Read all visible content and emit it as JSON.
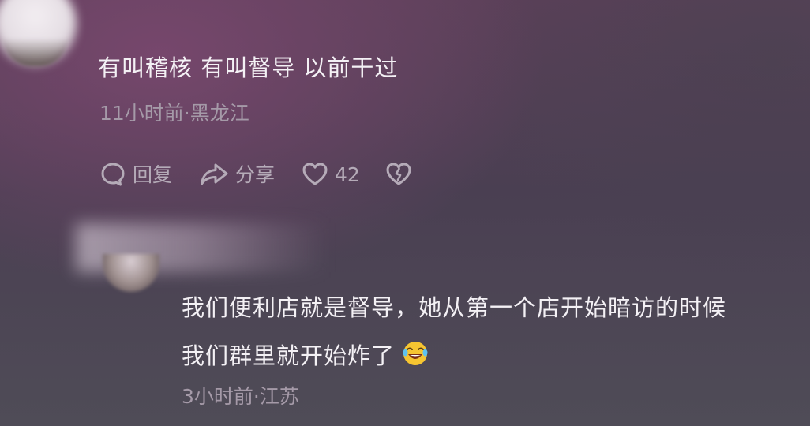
{
  "comment_1": {
    "text": "有叫稽核  有叫督导  以前干过",
    "meta": "11小时前·黑龙江",
    "actions": {
      "reply_label": "回复",
      "share_label": "分享",
      "like_count": "42"
    }
  },
  "comment_2": {
    "line1": "我们便利店就是督导，她从第一个店开始暗访的时候",
    "line2": "我们群里就开始炸了",
    "emoji": "laughing-crying-emoji",
    "meta": "3小时前·江苏"
  },
  "icons": [
    "comment-icon",
    "share-icon",
    "heart-icon",
    "broken-heart-icon",
    "laughing-crying-emoji"
  ],
  "colors": {
    "text": "#f4f1f5",
    "meta": "#a59aa8",
    "action": "#b5abb8",
    "background_accent": "#7c4870"
  }
}
